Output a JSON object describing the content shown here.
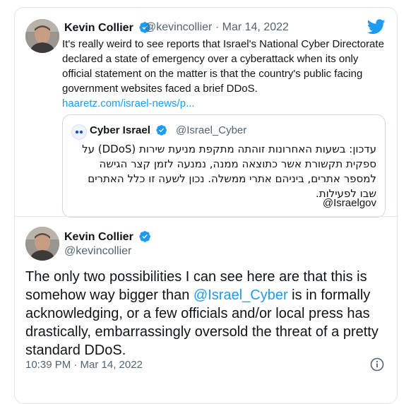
{
  "tweet": {
    "author_name": "Kevin Collier",
    "author_handle": "@kevincollier",
    "separator": "·",
    "date": "Mar 14, 2022",
    "text": "It's really weird to see reports that Israel's National Cyber Directorate declared a state of emergency over a cyberattack when its only official statement on the matter is that the country's public facing government websites faced a brief DDoS.",
    "link": "haaretz.com/israel-news/p..."
  },
  "quoted_tweet": {
    "author_name": "Cyber Israel",
    "author_handle": "@Israel_Cyber",
    "text_hebrew": "עדכון: בשעות האחרונות זוהתה מתקפת מניעת שירות (DDoS) על ספקית תקשורת אשר כתוצאה ממנה, נמנעה לזמן קצר הגישה למספר אתרים, ביניהם אתרי ממשלה. נכון לשעה זו כלל האתרים שבו לפעילות.",
    "tag": "@Israelgov"
  },
  "reply_tweet": {
    "author_name": "Kevin Collier",
    "author_handle": "@kevincollier",
    "text_before": "The only two possibilities I can see here are that this is somehow way bigger than ",
    "mention": "@Israel_Cyber",
    "text_after": " is in formally acknowledging, or a few officials and/or local press has drastically, embarrassingly oversold the threat of a pretty standard DDoS.",
    "timestamp": "10:39 PM · Mar 14, 2022"
  },
  "colors": {
    "twitter_blue": "#1d9bf0",
    "text_primary": "#0f1419",
    "text_secondary": "#536471",
    "border": "#cfd9de"
  },
  "icons": {
    "logo": "twitter-bird-icon",
    "verified": "verified-badge-icon",
    "info": "info-icon"
  }
}
